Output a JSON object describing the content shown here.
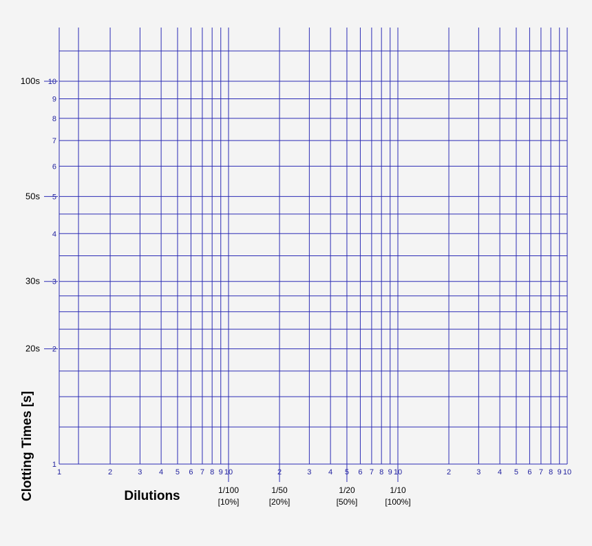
{
  "chart_data": {
    "type": "line",
    "title": "",
    "xlabel": "Dilutions",
    "ylabel": "Clotting Times [s]",
    "x_scale": "log",
    "y_scale": "log",
    "x_decades": 3,
    "y_decades": 1,
    "x_tick_labels": [
      "1",
      "2",
      "3",
      "4",
      "5",
      "6",
      "7",
      "8",
      "9",
      "10",
      "2",
      "3",
      "4",
      "5",
      "6",
      "7",
      "8",
      "9",
      "10",
      "2",
      "3",
      "4",
      "5",
      "6",
      "7",
      "8",
      "9",
      "10"
    ],
    "y_tick_labels": [
      "1",
      "2",
      "3",
      "4",
      "5",
      "6",
      "7",
      "8",
      "9",
      "10"
    ],
    "y_annotations": [
      {
        "text": "100s",
        "value": 10
      },
      {
        "text": "50s",
        "value": 5
      },
      {
        "text": "30s",
        "value": 3
      },
      {
        "text": "20s",
        "value": 2
      }
    ],
    "x_annotations": [
      {
        "ratio": "1/100",
        "percent": "[10%]",
        "value": 10
      },
      {
        "ratio": "1/50",
        "percent": "[20%]",
        "value": 20
      },
      {
        "ratio": "1/20",
        "percent": "[50%]",
        "value": 50
      },
      {
        "ratio": "1/10",
        "percent": "[100%]",
        "value": 100
      }
    ],
    "grid": true,
    "colors": {
      "grid": "#2a2ab5",
      "tick_label": "#1f1f9e",
      "text": "#000000",
      "background": "#f4f4f4"
    },
    "series": []
  }
}
